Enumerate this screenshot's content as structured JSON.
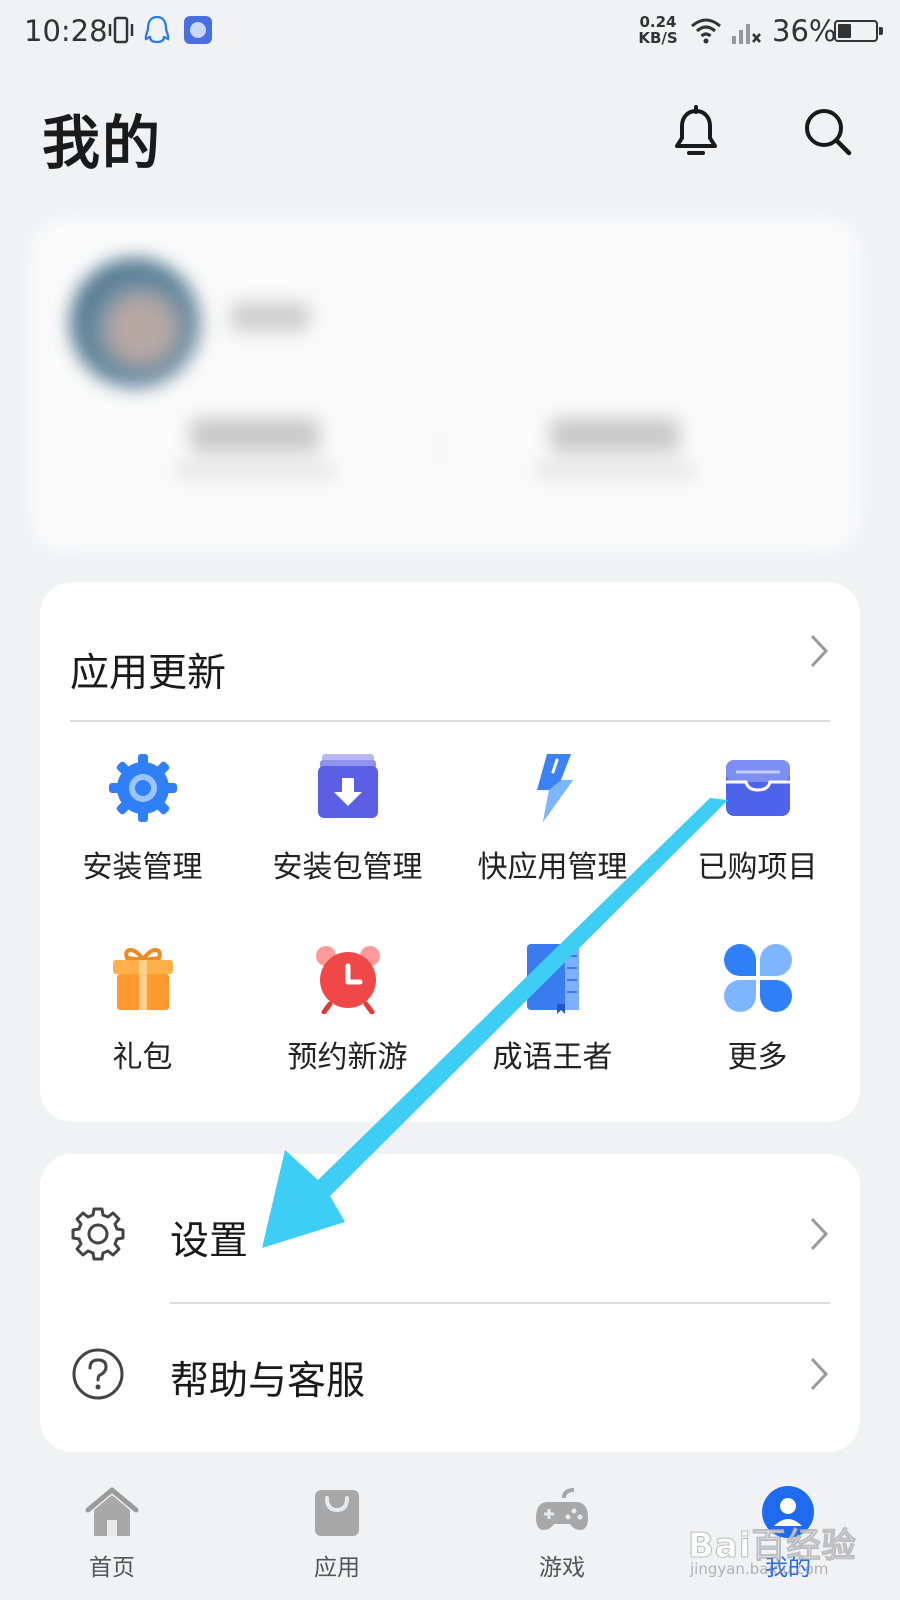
{
  "status_bar": {
    "time": "10:28",
    "net_speed_value": "0.24",
    "net_speed_unit": "KB/S",
    "battery_text": "36%",
    "battery_level": 0.36,
    "icons": [
      "vibrate-icon",
      "qq-icon",
      "app-notification-icon",
      "wifi-icon",
      "no-signal-icon",
      "battery-icon"
    ]
  },
  "header": {
    "title": "我的",
    "actions": [
      "bell-icon",
      "search-icon"
    ]
  },
  "tools_card": {
    "title": "应用更新",
    "items": [
      {
        "label": "安装管理",
        "icon": "gear-blue-icon"
      },
      {
        "label": "安装包管理",
        "icon": "package-download-icon"
      },
      {
        "label": "快应用管理",
        "icon": "lightning-icon"
      },
      {
        "label": "已购项目",
        "icon": "wallet-icon"
      },
      {
        "label": "礼包",
        "icon": "gift-icon"
      },
      {
        "label": "预约新游",
        "icon": "alarm-clock-icon"
      },
      {
        "label": "成语王者",
        "icon": "book-icon"
      },
      {
        "label": "更多",
        "icon": "four-petal-icon"
      }
    ]
  },
  "settings_card": {
    "items": [
      {
        "label": "设置",
        "icon": "gear-outline-icon"
      },
      {
        "label": "帮助与客服",
        "icon": "question-circle-icon"
      }
    ]
  },
  "bottom_nav": {
    "items": [
      {
        "label": "首页",
        "icon": "home-icon",
        "active": false
      },
      {
        "label": "应用",
        "icon": "shopping-bag-icon",
        "active": false
      },
      {
        "label": "游戏",
        "icon": "gamepad-icon",
        "active": false
      },
      {
        "label": "我的",
        "icon": "profile-icon",
        "active": true
      }
    ]
  },
  "watermark": {
    "text": "Bai百经验",
    "sub": "jingyan.baidu.com"
  },
  "colors": {
    "accent": "#1f6bf0",
    "annotation_arrow": "#3dcdf5",
    "background": "#f1f2f4"
  }
}
